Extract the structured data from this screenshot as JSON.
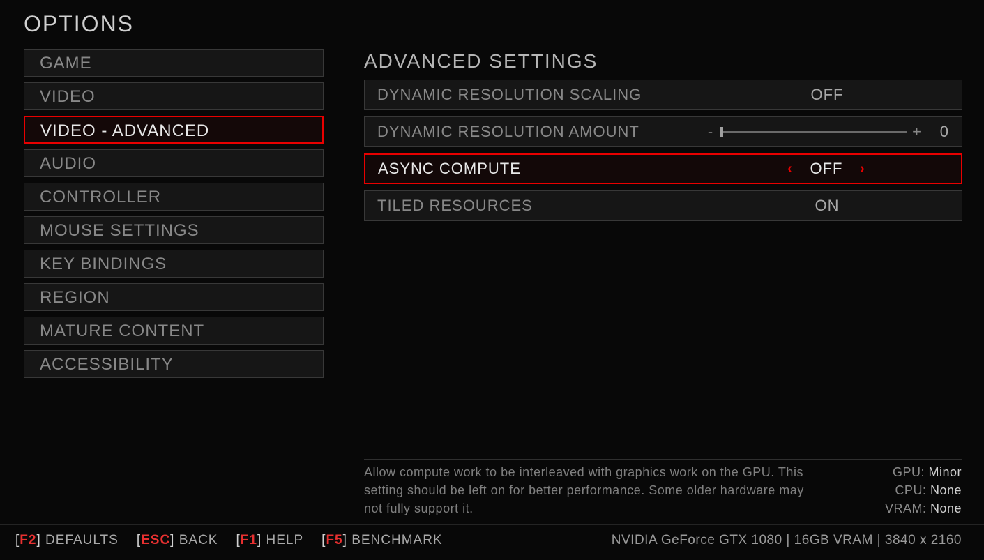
{
  "title": "OPTIONS",
  "sidebar": {
    "items": [
      {
        "label": "GAME"
      },
      {
        "label": "VIDEO"
      },
      {
        "label": "VIDEO - ADVANCED"
      },
      {
        "label": "AUDIO"
      },
      {
        "label": "CONTROLLER"
      },
      {
        "label": "MOUSE SETTINGS"
      },
      {
        "label": "KEY BINDINGS"
      },
      {
        "label": "REGION"
      },
      {
        "label": "MATURE CONTENT"
      },
      {
        "label": "ACCESSIBILITY"
      }
    ],
    "active_index": 2
  },
  "main": {
    "title": "ADVANCED SETTINGS",
    "settings": [
      {
        "label": "DYNAMIC RESOLUTION SCALING",
        "type": "choice",
        "value": "OFF"
      },
      {
        "label": "DYNAMIC RESOLUTION AMOUNT",
        "type": "slider",
        "value": "0",
        "minus": "-",
        "plus": "+"
      },
      {
        "label": "ASYNC COMPUTE",
        "type": "choice",
        "value": "OFF"
      },
      {
        "label": "TILED RESOURCES",
        "type": "choice",
        "value": "ON"
      }
    ],
    "active_index": 2
  },
  "description": "Allow compute work to be interleaved with graphics work on the GPU. This setting should be left on for better performance. Some older hardware may not fully support it.",
  "impact": {
    "gpu_label": "GPU:",
    "gpu_value": "Minor",
    "cpu_label": "CPU:",
    "cpu_value": "None",
    "vram_label": "VRAM:",
    "vram_value": "None"
  },
  "footer": {
    "hints": [
      {
        "key": "F2",
        "label": "DEFAULTS"
      },
      {
        "key": "ESC",
        "label": "BACK"
      },
      {
        "key": "F1",
        "label": "HELP"
      },
      {
        "key": "F5",
        "label": "BENCHMARK"
      }
    ],
    "hardware": "NVIDIA GeForce GTX 1080 | 16GB VRAM | 3840 x 2160"
  }
}
